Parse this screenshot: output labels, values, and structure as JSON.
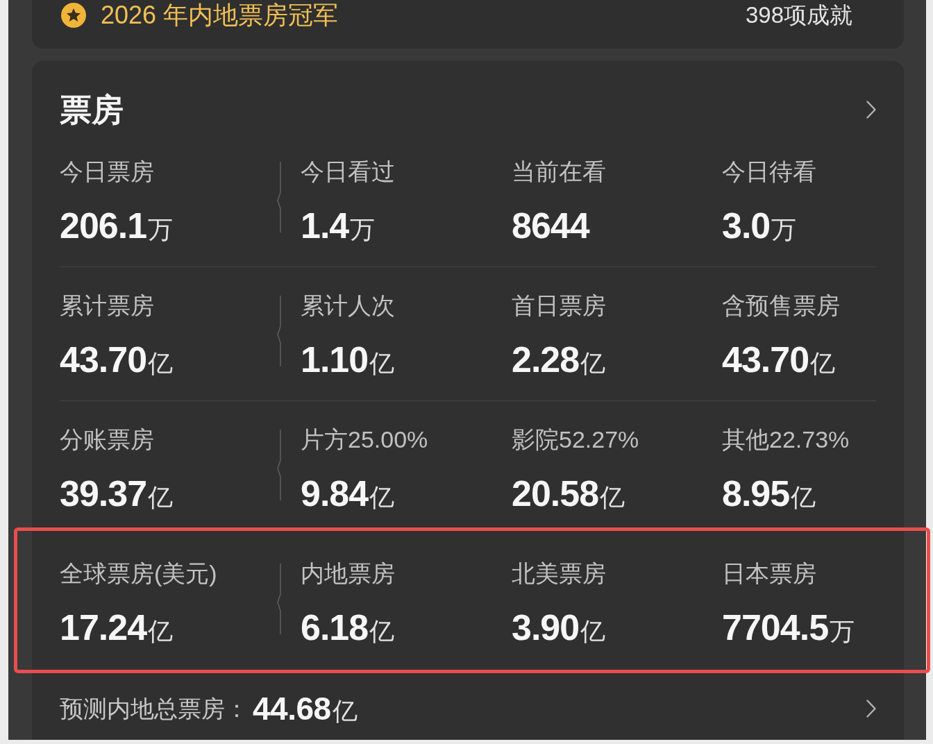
{
  "achievement_card": {
    "title": "2026 年内地票房冠军",
    "count": "398项成就"
  },
  "box_office": {
    "title": "票房",
    "rows": [
      {
        "highlighted": false,
        "cells": [
          {
            "label": "今日票房",
            "value": "206.1",
            "unit": "万"
          },
          {
            "label": "今日看过",
            "value": "1.4",
            "unit": "万"
          },
          {
            "label": "当前在看",
            "value": "8644"
          },
          {
            "label": "今日待看",
            "value": "3.0",
            "unit": "万"
          }
        ]
      },
      {
        "highlighted": false,
        "cells": [
          {
            "label": "累计票房",
            "value": "43.70",
            "unit": "亿"
          },
          {
            "label": "累计人次",
            "value": "1.10",
            "unit": "亿"
          },
          {
            "label": "首日票房",
            "value": "2.28",
            "unit": "亿"
          },
          {
            "label": "含预售票房",
            "value": "43.70",
            "unit": "亿"
          }
        ]
      },
      {
        "highlighted": false,
        "cells": [
          {
            "label": "分账票房",
            "value": "39.37",
            "unit": "亿"
          },
          {
            "label": "片方25.00%",
            "value": "9.84",
            "unit": "亿"
          },
          {
            "label": "影院52.27%",
            "value": "20.58",
            "unit": "亿"
          },
          {
            "label": "其他22.73%",
            "value": "8.95",
            "unit": "亿"
          }
        ]
      },
      {
        "highlighted": true,
        "cells": [
          {
            "label": "全球票房(美元)",
            "value": "17.24",
            "unit": "亿"
          },
          {
            "label": "内地票房",
            "value": "6.18",
            "unit": "亿"
          },
          {
            "label": "北美票房",
            "value": "3.90",
            "unit": "亿"
          },
          {
            "label": "日本票房",
            "value": "7704.5",
            "unit": "万"
          }
        ]
      }
    ],
    "forecast": {
      "label": "预测内地总票房：",
      "value": "44.68",
      "unit": "亿"
    }
  }
}
